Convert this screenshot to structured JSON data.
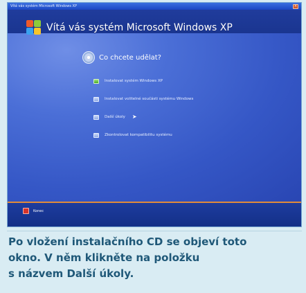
{
  "window": {
    "title": "Vítá vás systém Microsoft Windows XP",
    "close_glyph": "×"
  },
  "welcome": {
    "text": "Vítá vás systém Microsoft Windows XP",
    "logo_icon": "windows-logo-icon"
  },
  "question": {
    "text": "Co chcete udělat?",
    "icon": "cd-icon"
  },
  "menu": {
    "items": [
      {
        "label": "Instalovat systém Windows XP",
        "active": true
      },
      {
        "label": "Instalovat volitelné součásti systému Windows",
        "active": false
      },
      {
        "label": "Další úkoly",
        "active": false
      },
      {
        "label": "Zkontrolovat kompatibilitu systému",
        "active": false
      }
    ]
  },
  "exit": {
    "label": "Konec",
    "icon": "exit-icon"
  },
  "caption": {
    "line1": "Po vložení instalačního CD se objeví toto",
    "line2": "okno. V něm klikněte na položku",
    "line3": "s názvem Další úkoly."
  },
  "colors": {
    "panel_blue": "#3557c6",
    "band_blue": "#1a3590",
    "accent_orange": "#e18b3a",
    "caption_text": "#1f5878"
  }
}
